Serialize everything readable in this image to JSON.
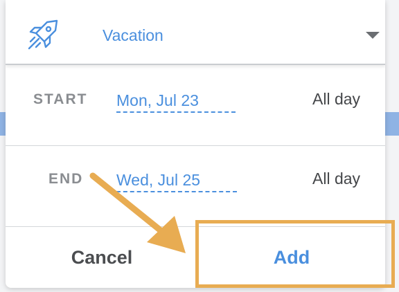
{
  "event_type": {
    "label": "Vacation",
    "icon": "rocket-icon"
  },
  "start": {
    "label": "START",
    "date": "Mon, Jul 23",
    "time": "All day"
  },
  "end": {
    "label": "END",
    "date": "Wed, Jul 25",
    "time": "All day"
  },
  "actions": {
    "cancel_label": "Cancel",
    "add_label": "Add"
  },
  "colors": {
    "accent": "#4a8fde",
    "annotation": "#e8ac52",
    "label_gray": "#8a8d91"
  }
}
